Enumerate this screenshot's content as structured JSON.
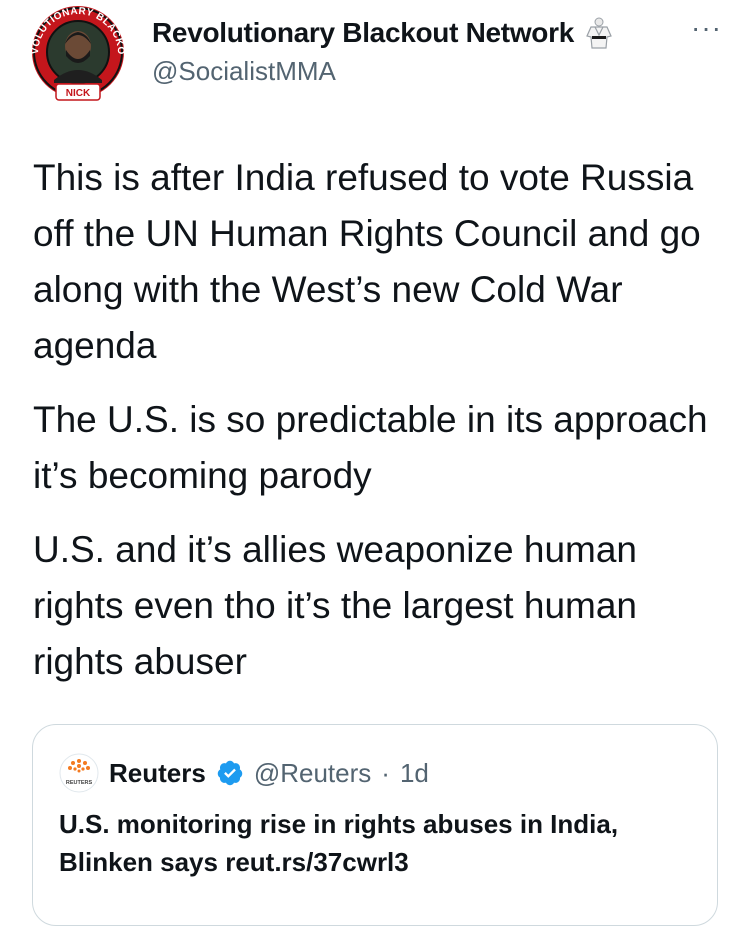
{
  "header": {
    "avatar_caption": "NICK",
    "avatar_ring_text": "REVOLUTIONARY BLACKOUT",
    "name": "Revolutionary Blackout Network",
    "name_icon": "martial-arts-gi-icon",
    "handle": "@SocialistMMA",
    "more_label": "···"
  },
  "tweet": {
    "paragraphs": [
      "This is after India refused to vote Russia off the UN Human Rights Council and go along with the West’s new Cold War agenda",
      "The U.S. is so predictable in its approach it’s becoming parody",
      "U.S. and it’s allies weaponize human rights even tho it’s the largest human rights abuser"
    ]
  },
  "quote": {
    "logo_text": "REUTERS",
    "name": "Reuters",
    "verified_icon": "verified-badge-icon",
    "handle": "@Reuters",
    "separator": "·",
    "time": "1d",
    "body": "U.S. monitoring rise in rights abuses in India, Blinken says reut.rs/37cwrl3"
  },
  "colors": {
    "text": "#0f1419",
    "secondary": "#536471",
    "border": "#cfd9de",
    "verified": "#1d9bf0",
    "avatar_ring": "#c4161c"
  }
}
